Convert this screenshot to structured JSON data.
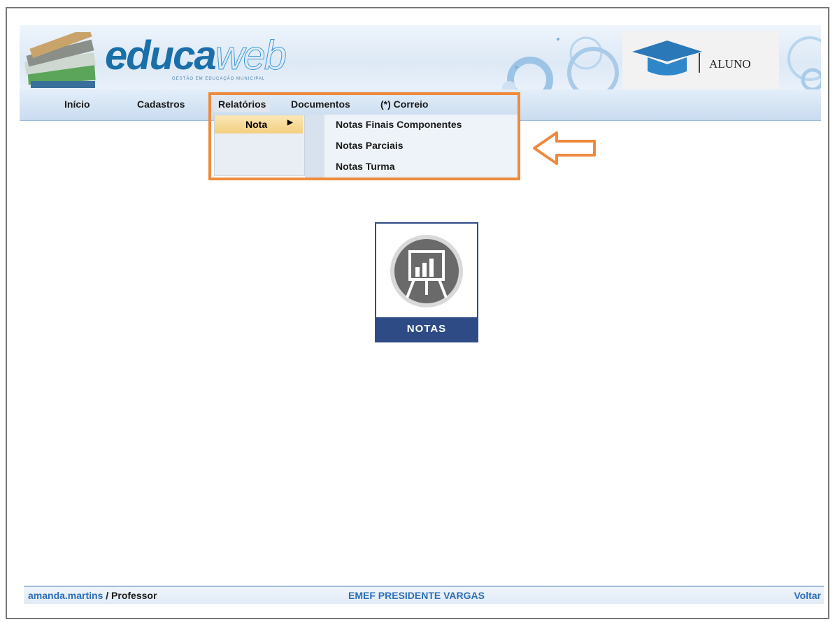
{
  "header": {
    "logo_main": "educa",
    "logo_accent": "web",
    "logo_subtitle": "GESTÃO EM EDUCAÇÃO MUNICIPAL",
    "profile_label": "ALUNO"
  },
  "nav": {
    "items": [
      {
        "label": "Início"
      },
      {
        "label": "Cadastros"
      },
      {
        "label": "Relatórios"
      },
      {
        "label": "Documentos"
      },
      {
        "label": "(*) Correio"
      }
    ]
  },
  "dropdown": {
    "submenu_label": "Nota",
    "items": [
      {
        "label": "Notas Finais Componentes"
      },
      {
        "label": "Notas Parciais"
      },
      {
        "label": "Notas Turma"
      }
    ]
  },
  "tile": {
    "label": "NOTAS",
    "icon": "chart-easel-icon"
  },
  "footer": {
    "username": "amanda.martins",
    "separator": " / ",
    "role": "Professor",
    "school": "EMEF PRESIDENTE VARGAS",
    "back_label": "Voltar"
  },
  "colors": {
    "accent_orange": "#ee8a3d",
    "brand_blue": "#2e4b85",
    "link_blue": "#2d6fb8"
  }
}
